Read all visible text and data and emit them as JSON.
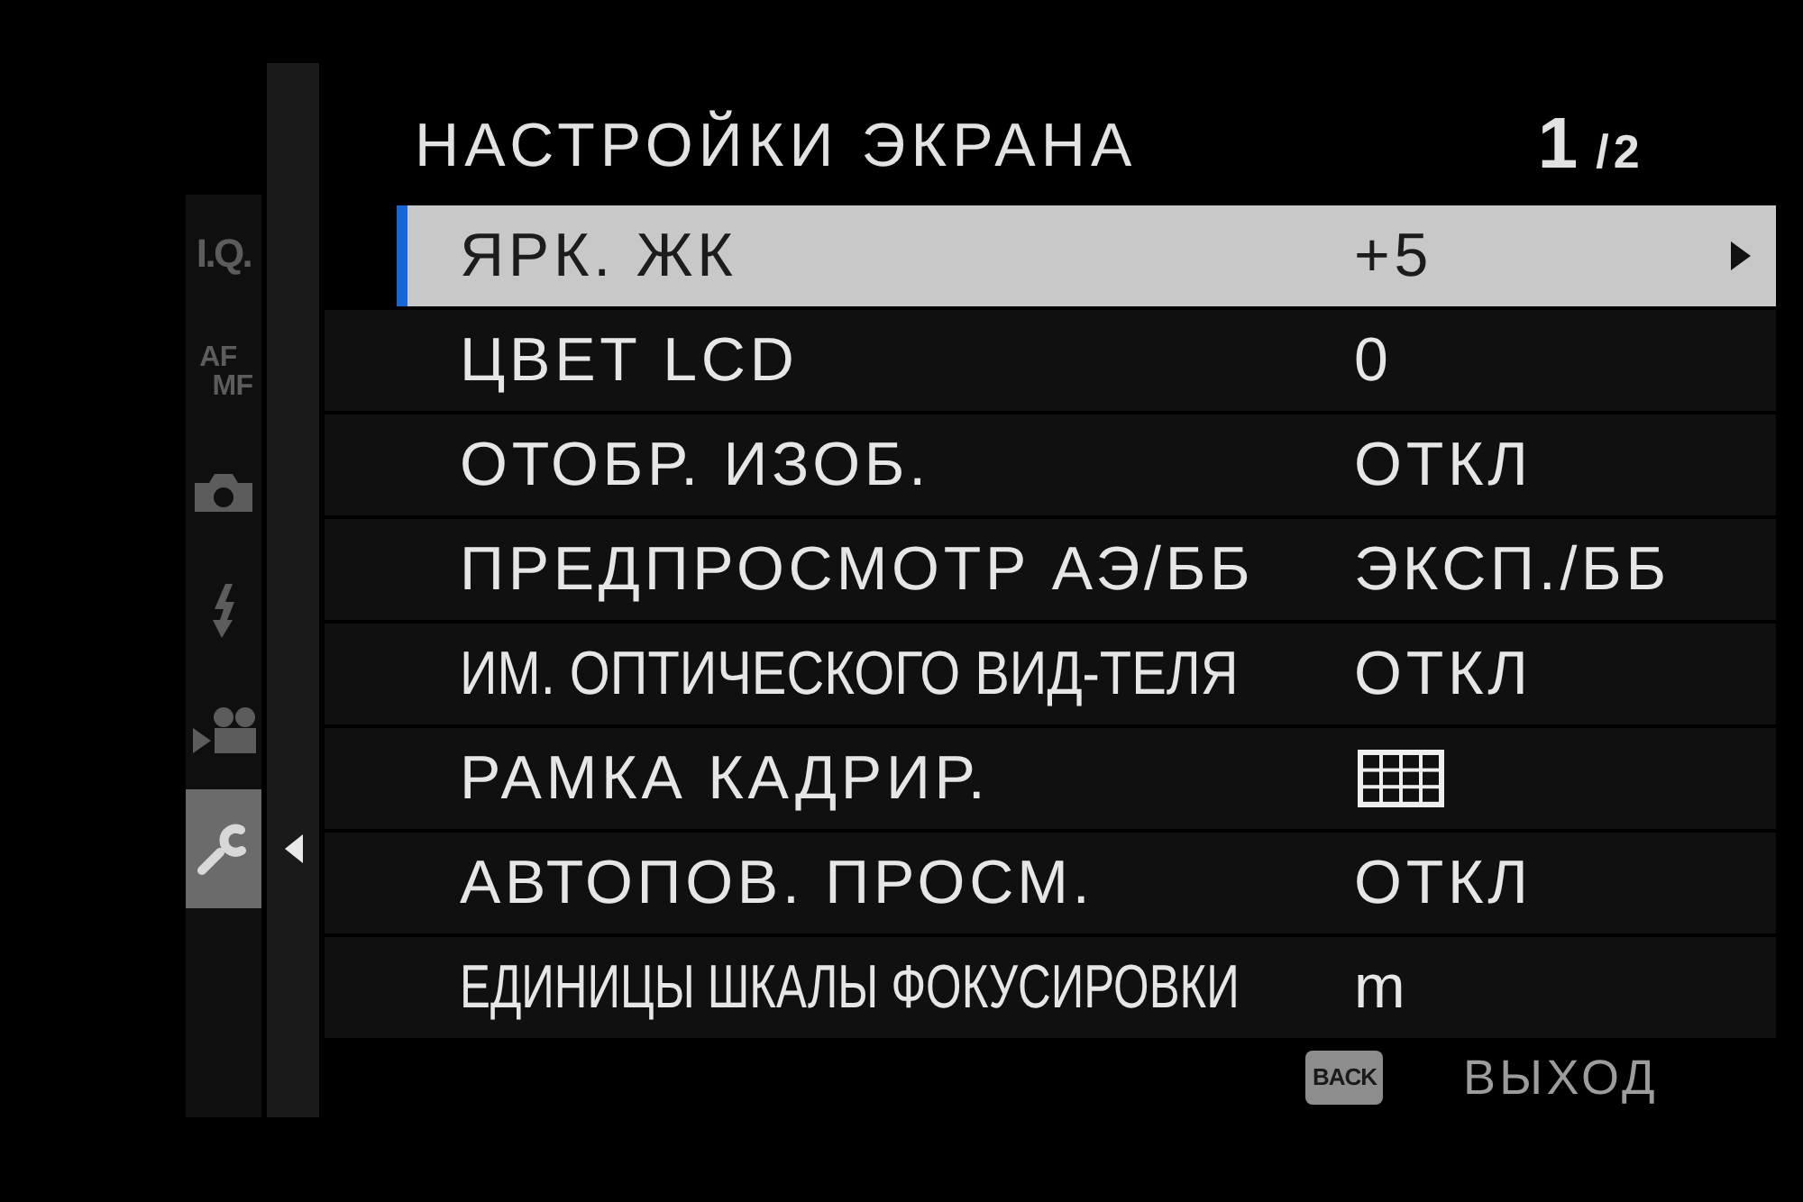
{
  "sidebar": {
    "items": [
      {
        "kind": "text",
        "lines": [
          "I.Q."
        ],
        "selected": false
      },
      {
        "kind": "text",
        "lines": [
          "AF",
          "MF"
        ],
        "selected": false
      },
      {
        "kind": "camera",
        "selected": false
      },
      {
        "kind": "flash",
        "selected": false
      },
      {
        "kind": "movie",
        "selected": false
      },
      {
        "kind": "wrench",
        "selected": true
      }
    ]
  },
  "header": {
    "title": "НАСТРОЙКИ ЭКРАНА",
    "page": {
      "current": "1",
      "of_total": "/2"
    }
  },
  "rows": [
    {
      "label": "ЯРК. ЖК",
      "kind": "text",
      "value": "+5",
      "selected": true
    },
    {
      "label": "ЦВЕТ LCD",
      "kind": "text",
      "value": "0",
      "selected": false
    },
    {
      "label": "ОТОБР. ИЗОБ.",
      "kind": "text",
      "value": "ОТКЛ",
      "selected": false
    },
    {
      "label": "ПРЕДПРОСМОТР АЭ/ББ",
      "kind": "text",
      "value": "ЭКСП./ББ",
      "selected": false
    },
    {
      "label": "ИМ. ОПТИЧЕСКОГО ВИД-ТЕЛЯ",
      "kind": "text",
      "value": "ОТКЛ",
      "selected": false
    },
    {
      "label": "РАМКА КАДРИР.",
      "kind": "grid",
      "selected": false
    },
    {
      "label": "АВТОПОВ. ПРОСМ.",
      "kind": "text",
      "value": "ОТКЛ",
      "selected": false
    },
    {
      "label": "ЕДИНИЦЫ ШКАЛЫ ФОКУСИРОВКИ",
      "kind": "text",
      "value": "m",
      "selected": false
    }
  ],
  "footer": {
    "key": "BACK",
    "label": "ВЫХОД"
  }
}
